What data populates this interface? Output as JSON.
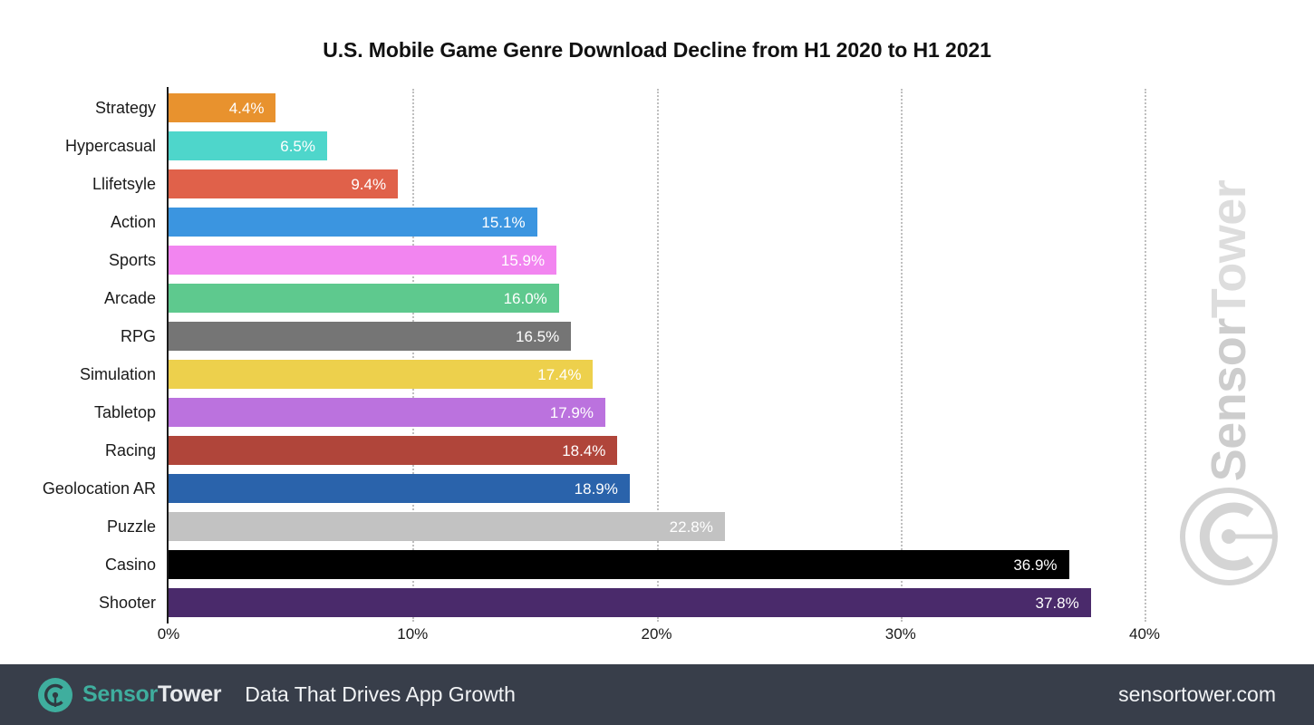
{
  "chart_data": {
    "type": "bar",
    "orientation": "horizontal",
    "title": "U.S. Mobile Game Genre Download Decline from H1 2020 to H1 2021",
    "xlabel": "",
    "ylabel": "",
    "xlim": [
      0,
      40
    ],
    "grid": true,
    "legend": "none",
    "x_ticks": [
      "0%",
      "10%",
      "20%",
      "30%",
      "40%"
    ],
    "x_tick_values": [
      0,
      10,
      20,
      30,
      40
    ],
    "categories": [
      "Strategy",
      "Hypercasual",
      "Llifetsyle",
      "Action",
      "Sports",
      "Arcade",
      "RPG",
      "Simulation",
      "Tabletop",
      "Racing",
      "Geolocation AR",
      "Puzzle",
      "Casino",
      "Shooter"
    ],
    "values": [
      4.4,
      6.5,
      9.4,
      15.1,
      15.9,
      16.0,
      16.5,
      17.4,
      17.9,
      18.4,
      18.9,
      22.8,
      36.9,
      37.8
    ],
    "value_labels": [
      "4.4%",
      "6.5%",
      "9.4%",
      "15.1%",
      "15.9%",
      "16.0%",
      "16.5%",
      "17.4%",
      "17.9%",
      "18.4%",
      "18.9%",
      "22.8%",
      "36.9%",
      "37.8%"
    ],
    "colors": [
      "#e8922e",
      "#4ed6cb",
      "#e0614a",
      "#3b95e0",
      "#f285f0",
      "#5ec98e",
      "#757575",
      "#edd04c",
      "#bb72de",
      "#b0453a",
      "#2a63ab",
      "#c2c2c2",
      "#000000",
      "#4a2a6b"
    ]
  },
  "watermark": {
    "brand_first": "Sensor",
    "brand_second": "Tower",
    "logo_icon": "sensortower-signal-icon"
  },
  "footer": {
    "logo_icon": "sensortower-signal-icon",
    "brand_first": "Sensor",
    "brand_second": "Tower",
    "tagline": "Data That Drives App Growth",
    "url": "sensortower.com",
    "background_color": "#383e4a",
    "brand_color": "#3fae9e"
  }
}
